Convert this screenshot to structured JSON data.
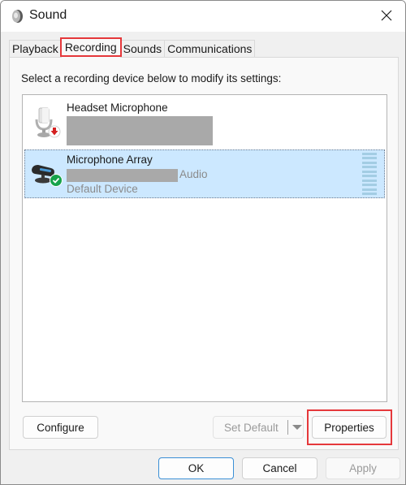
{
  "window": {
    "title": "Sound",
    "icon": "speaker-icon",
    "close_icon": "close-icon"
  },
  "tabs": [
    {
      "label": "Playback",
      "active": false
    },
    {
      "label": "Recording",
      "active": true,
      "highlighted": true
    },
    {
      "label": "Sounds",
      "active": false
    },
    {
      "label": "Communications",
      "active": false
    }
  ],
  "panel": {
    "instruction": "Select a recording device below to modify its settings:",
    "devices": [
      {
        "name": "Headset Microphone",
        "icon": "headset-microphone-icon",
        "status_badge": "disconnected-arrow-icon",
        "detail": "[redacted]",
        "selected": false
      },
      {
        "name": "Microphone Array",
        "icon": "microphone-array-icon",
        "status_badge": "default-check-icon",
        "detail": "[redacted]",
        "detail_suffix": "Audio",
        "status": "Default Device",
        "selected": true,
        "level_meter_segments": 10
      }
    ],
    "buttons": {
      "configure": "Configure",
      "set_default": "Set Default",
      "properties": "Properties"
    }
  },
  "footer": {
    "ok": "OK",
    "cancel": "Cancel",
    "apply": "Apply"
  },
  "colors": {
    "highlight": "#e5383b",
    "selection": "#cce8ff",
    "default_badge": "#16a34a",
    "disconnected_badge": "#d42020"
  }
}
